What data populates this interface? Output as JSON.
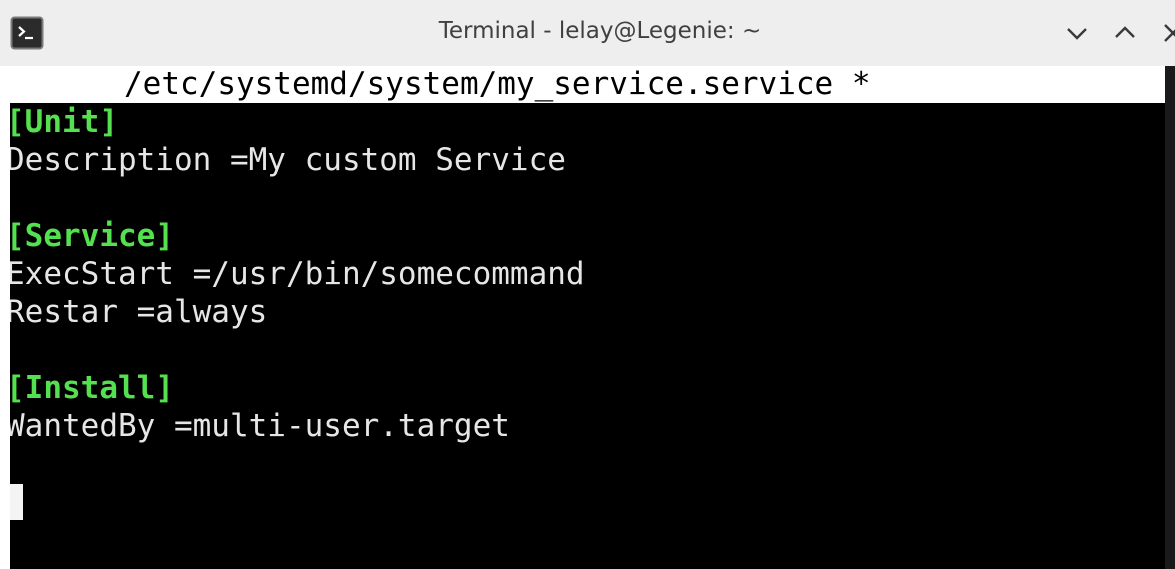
{
  "window": {
    "title": "Terminal - lelay@Legenie: ~",
    "icons": {
      "app": "terminal-icon",
      "minimize": "chevron-down-icon",
      "maximize": "chevron-up-icon",
      "close": "close-icon"
    }
  },
  "editor": {
    "header": "/etc/systemd/system/my_service.service *",
    "lines": [
      "[Unit]",
      "Description =My custom Service",
      "",
      "[Service]",
      "ExecStart =/usr/bin/somecommand",
      "Restar =always",
      "",
      "[Install]",
      "WantedBy =multi-user.target"
    ]
  },
  "colors": {
    "section_header": "#54e04f",
    "text": "#e6e6e6",
    "background": "#000000"
  }
}
